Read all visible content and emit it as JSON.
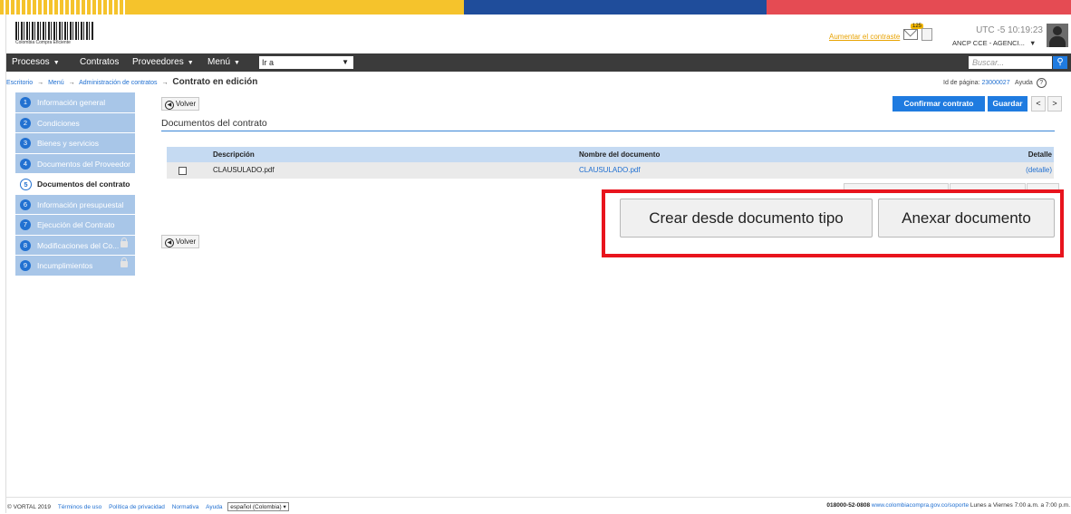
{
  "header": {
    "logo_text": "Colombia Compra Eficiente",
    "contrast_link": "Aumentar el contraste",
    "mail_badge": "125",
    "utc_time": "UTC -5 10:19:23",
    "org_menu": "ANCP CCE - AGENCI...",
    "org_caret": "▼"
  },
  "nav": {
    "items": [
      {
        "label": "Procesos",
        "caret": "▼"
      },
      {
        "label": "Contratos",
        "caret": ""
      },
      {
        "label": "Proveedores",
        "caret": "▼"
      },
      {
        "label": "Menú",
        "caret": "▼"
      }
    ],
    "goto_value": "Ir a",
    "goto_caret": "▼",
    "search_placeholder": "Buscar...",
    "search_icon": "search-icon"
  },
  "breadcrumb": {
    "items": [
      "Escritorio",
      "Menú",
      "Administración de contratos"
    ],
    "arrow": "→",
    "current": "Contrato en edición"
  },
  "page_meta": {
    "id_label": "Id de página:",
    "id_value": "23000027",
    "help_label": "Ayuda",
    "help_icon_glyph": "?"
  },
  "sidebar": {
    "items": [
      {
        "num": "1",
        "label": "Información general"
      },
      {
        "num": "2",
        "label": "Condiciones"
      },
      {
        "num": "3",
        "label": "Bienes y servicios"
      },
      {
        "num": "4",
        "label": "Documentos del Proveedor"
      },
      {
        "num": "5",
        "label": "Documentos del contrato"
      },
      {
        "num": "6",
        "label": "Información presupuestal"
      },
      {
        "num": "7",
        "label": "Ejecución del Contrato"
      },
      {
        "num": "8",
        "label": "Modificaciones del Co..."
      },
      {
        "num": "9",
        "label": "Incumplimientos"
      }
    ]
  },
  "toolbar": {
    "back_label": "Volver",
    "back_icon_glyph": "◀",
    "confirm_label": "Confirmar contrato",
    "save_label": "Guardar",
    "prev_label": "<",
    "next_label": ">"
  },
  "section": {
    "title": "Documentos del contrato"
  },
  "table": {
    "headers": [
      "Descripción",
      "Nombre del documento",
      "Detalle"
    ],
    "rows": [
      {
        "description": "CLAUSULADO.pdf",
        "document_name": "CLAUSULADO.pdf",
        "detail": "(detalle)"
      }
    ]
  },
  "actions": {
    "create_from_template": "Crear desde documento tipo",
    "attach_document": "Anexar documento"
  },
  "footer": {
    "copyright": "© VORTAL 2019",
    "links": [
      "Términos de uso",
      "Política de privacidad",
      "Normativa",
      "Ayuda"
    ],
    "language": "español (Colombia)",
    "language_caret": "▾",
    "phone": "018000-52-0808",
    "support_url": "www.colombiacompra.gov.co/soporte",
    "hours": "Lunes a Viernes 7:00 a.m. a 7:00 p.m."
  },
  "colors": {
    "accent_blue": "#1f7be0",
    "highlight_red": "#e8141d",
    "nav_dark": "#3b3b3b"
  }
}
